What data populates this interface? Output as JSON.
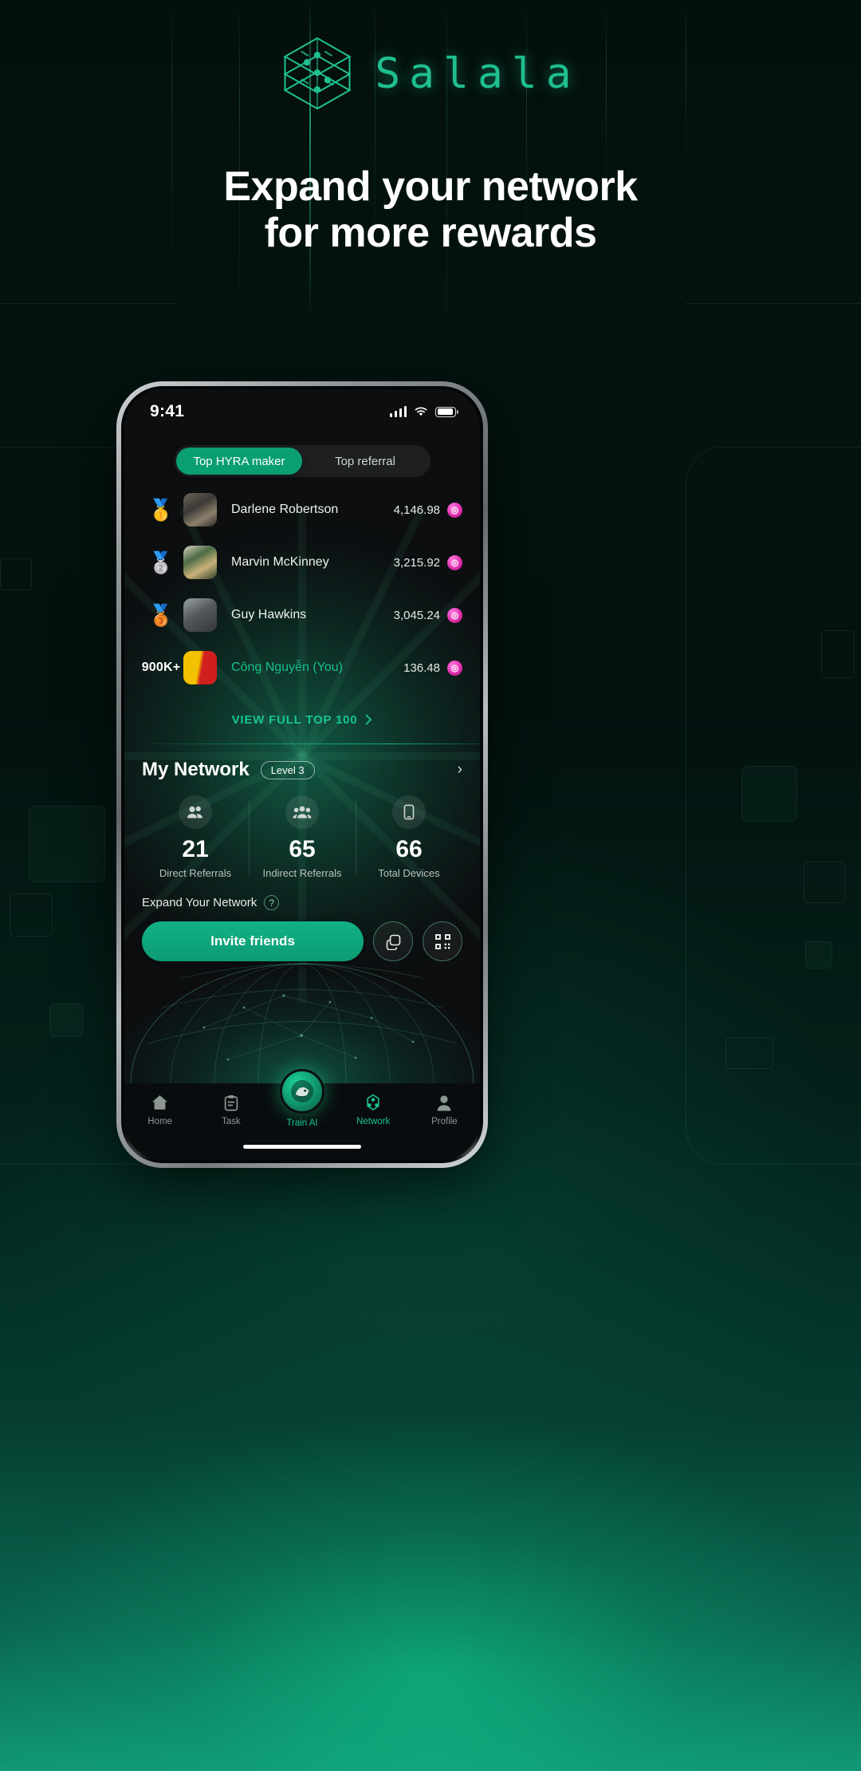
{
  "brand": {
    "name": "Salala",
    "logo_icon": "hex-network-logo-icon"
  },
  "headline": {
    "line1": "Expand your network",
    "line2": "for more rewards"
  },
  "phone": {
    "status_bar": {
      "time": "9:41",
      "signal_icon": "cellular-bars-icon",
      "wifi_icon": "wifi-icon",
      "battery_icon": "battery-full-icon"
    },
    "tabs": [
      {
        "label": "Top HYRA maker",
        "active": true
      },
      {
        "label": "Top referral",
        "active": false
      }
    ],
    "leaderboard": {
      "rows": [
        {
          "rank": "1",
          "rank_icon": "gold-medal-icon",
          "name": "Darlene Robertson",
          "score": "4,146.98",
          "is_you": false
        },
        {
          "rank": "2",
          "rank_icon": "silver-medal-icon",
          "name": "Marvin McKinney",
          "score": "3,215.92",
          "is_you": false
        },
        {
          "rank": "3",
          "rank_icon": "bronze-medal-icon",
          "name": "Guy Hawkins",
          "score": "3,045.24",
          "is_you": false
        },
        {
          "rank": "900K+",
          "rank_icon": "rank-text",
          "name": "Công Nguyễn (You)",
          "score": "136.48",
          "is_you": true
        }
      ],
      "view_full_label": "VIEW FULL TOP 100",
      "view_full_icon": "chevron-right-icon",
      "currency_icon": "hyra-coin-icon"
    },
    "network": {
      "title": "My Network",
      "level_badge": "Level 3",
      "chevron_icon": "chevron-right-icon",
      "stats": [
        {
          "icon": "two-people-icon",
          "value": "21",
          "label": "Direct Referrals"
        },
        {
          "icon": "group-people-icon",
          "value": "65",
          "label": "Indirect Referrals"
        },
        {
          "icon": "device-phone-icon",
          "value": "66",
          "label": "Total Devices"
        }
      ],
      "expand_label": "Expand Your Network",
      "help_icon": "question-mark-icon",
      "invite_button": "Invite friends",
      "copy_icon": "copy-icon",
      "qr_icon": "qr-code-icon"
    },
    "bottom_nav": [
      {
        "label": "Home",
        "icon": "home-icon",
        "active": false
      },
      {
        "label": "Task",
        "icon": "clipboard-icon",
        "active": false
      },
      {
        "label": "Train AI",
        "icon": "robot-avatar-icon",
        "active": false,
        "center": true
      },
      {
        "label": "Network",
        "icon": "network-nodes-icon",
        "active": true
      },
      {
        "label": "Profile",
        "icon": "person-icon",
        "active": false
      }
    ]
  },
  "colors": {
    "accent": "#12b185",
    "accent_bright": "#18c48d",
    "brand_green": "#1fbf8f",
    "coin_pink": "#e12fae",
    "text_primary": "#ffffff",
    "text_muted": "#b9c2bf"
  }
}
